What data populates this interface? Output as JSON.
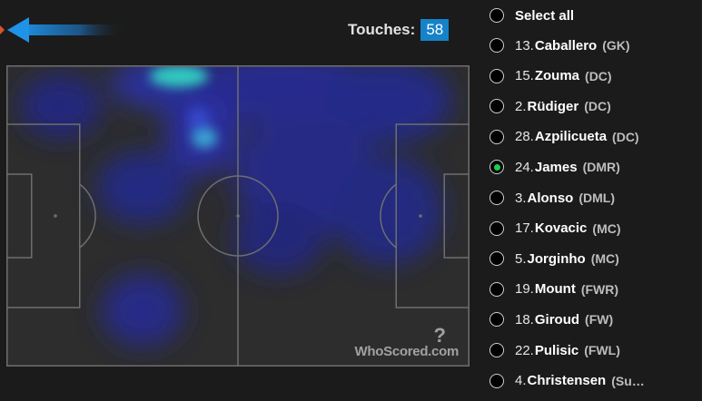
{
  "header": {
    "back_icon": "left-arrow-icon",
    "touches_label": "Touches:",
    "touches_value": "58"
  },
  "watermark": {
    "mark": "?",
    "text": "WhoScored.com"
  },
  "heatmap": {
    "colors": {
      "pitch": "#2d2d2d",
      "lines": "#6e6e6e",
      "low": "#2a2fa8",
      "high": "#35d7c4"
    }
  },
  "players": {
    "select_all": "Select all",
    "items": [
      {
        "num": "13.",
        "name": "Caballero",
        "pos": "(GK)",
        "selected": false
      },
      {
        "num": "15.",
        "name": "Zouma",
        "pos": "(DC)",
        "selected": false
      },
      {
        "num": "2.",
        "name": "Rüdiger",
        "pos": "(DC)",
        "selected": false
      },
      {
        "num": "28.",
        "name": "Azpilicueta",
        "pos": "(DC)",
        "selected": false
      },
      {
        "num": "24.",
        "name": "James",
        "pos": "(DMR)",
        "selected": true
      },
      {
        "num": "3.",
        "name": "Alonso",
        "pos": "(DML)",
        "selected": false
      },
      {
        "num": "17.",
        "name": "Kovacic",
        "pos": "(MC)",
        "selected": false
      },
      {
        "num": "5.",
        "name": "Jorginho",
        "pos": "(MC)",
        "selected": false
      },
      {
        "num": "19.",
        "name": "Mount",
        "pos": "(FWR)",
        "selected": false
      },
      {
        "num": "18.",
        "name": "Giroud",
        "pos": "(FW)",
        "selected": false
      },
      {
        "num": "22.",
        "name": "Pulisic",
        "pos": "(FWL)",
        "selected": false
      },
      {
        "num": "4.",
        "name": "Christensen",
        "pos": "(Su…",
        "selected": false
      }
    ]
  }
}
